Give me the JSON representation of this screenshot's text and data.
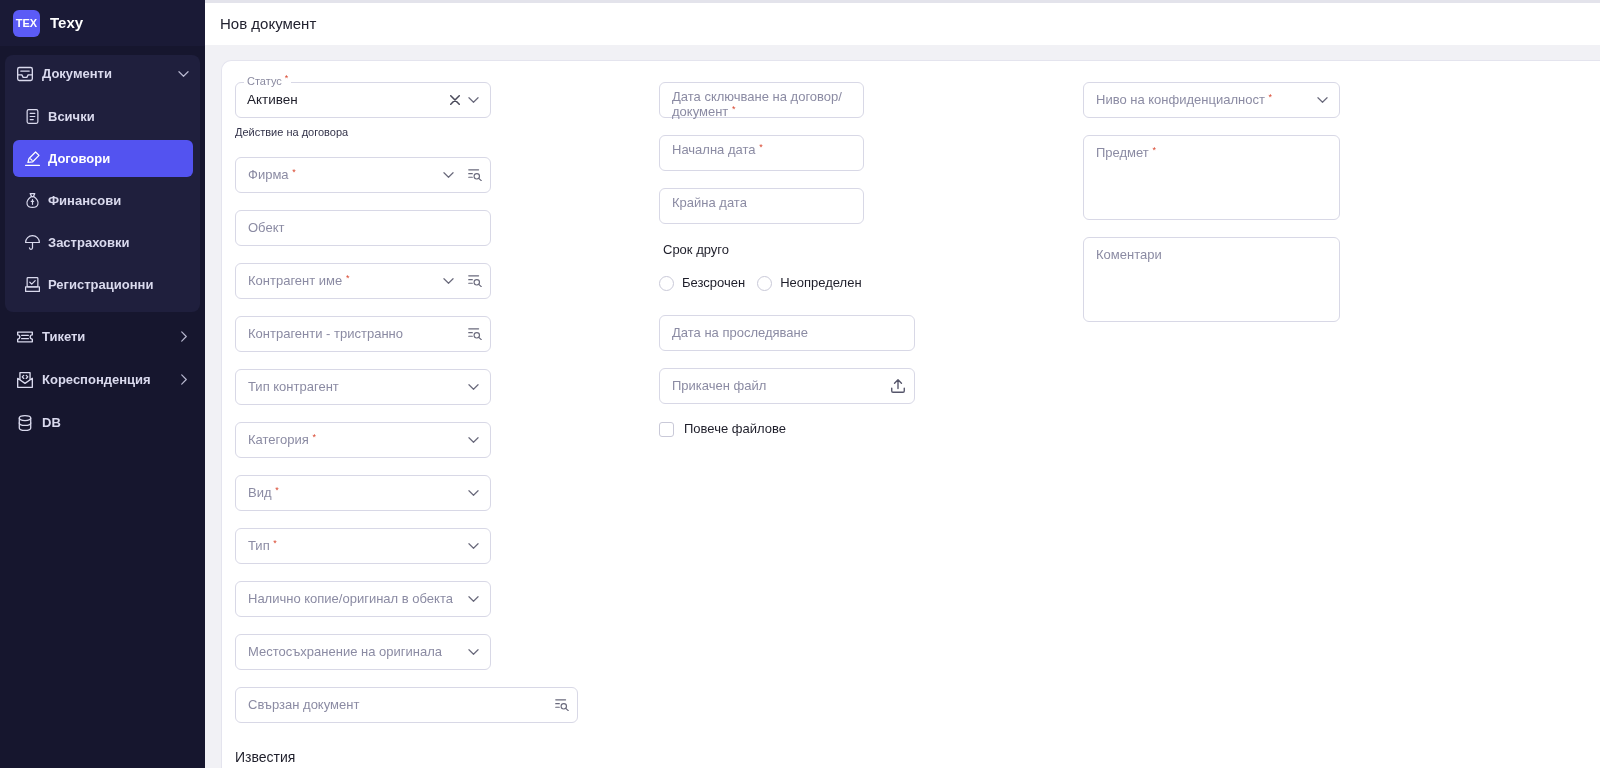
{
  "sidebar": {
    "logo": "TEX",
    "app_name": "Texy",
    "items": [
      {
        "label": "Документи",
        "selected": false,
        "expanded": true,
        "children": [
          {
            "label": "Всички",
            "selected": false
          },
          {
            "label": "Договори",
            "selected": true
          },
          {
            "label": "Финансови",
            "selected": false
          },
          {
            "label": "Застраховки",
            "selected": false
          },
          {
            "label": "Регистрационни",
            "selected": false
          }
        ]
      },
      {
        "label": "Тикети",
        "selected": false,
        "expanded": false
      },
      {
        "label": "Кореспонденция",
        "selected": false,
        "expanded": false
      },
      {
        "label": "DB",
        "selected": false
      }
    ]
  },
  "header": {
    "title": "Нов документ"
  },
  "form": {
    "columns": [
      [
        {
          "kind": "select",
          "label": "Статус $^{*}$",
          "value": "Активен",
          "clearable": true,
          "helper": "Действие на договора"
        },
        {
          "kind": "select_search",
          "label": "Фирма $^{*}$"
        },
        {
          "kind": "text",
          "label": "Обект"
        },
        {
          "kind": "select_search",
          "label": "Контрагент име $^{*}$"
        },
        {
          "kind": "search",
          "label": "Контрагенти - тристранно"
        },
        {
          "kind": "select",
          "label": "Тип контрагент"
        },
        {
          "kind": "select",
          "label": "Категория $^{*}$"
        },
        {
          "kind": "select",
          "label": "Вид $^{*}$"
        },
        {
          "kind": "select",
          "label": "Тип $^{*}$"
        },
        {
          "kind": "select",
          "label": "Налично копие/оригинал в обекта"
        },
        {
          "kind": "select",
          "label": "Местосъхранение на оригинала"
        },
        {
          "kind": "search",
          "label": "Свързан документ"
        }
      ],
      [
        {
          "kind": "text",
          "label": "Дата сключване на договор/ документ $^{*}$"
        },
        {
          "kind": "text",
          "label": "Начална дата $^{*}$"
        },
        {
          "kind": "text",
          "label": "Крайна дата"
        },
        {
          "kind": "radio_group",
          "label": "Срок друго",
          "options": [
            {
              "label": "Безсрочен",
              "selected": false
            },
            {
              "label": "Неопределен",
              "selected": false
            }
          ]
        },
        {
          "kind": "text",
          "label": "Дата на проследяване"
        },
        {
          "kind": "file",
          "label": "Прикачен файл"
        },
        {
          "kind": "checkbox",
          "label": "Повече файлове",
          "checked": false
        }
      ],
      [
        {
          "kind": "select",
          "label": "Ниво на конфиденциалност $^{*}$"
        },
        {
          "kind": "textarea",
          "label": "Предмет $^{*}$"
        },
        {
          "kind": "textarea",
          "label": "Коментари"
        }
      ]
    ],
    "section_title": "Известия"
  }
}
